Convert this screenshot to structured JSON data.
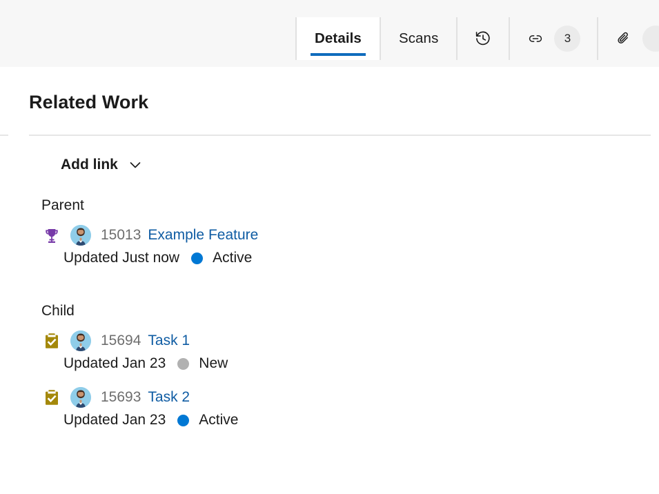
{
  "tabbar": {
    "tabs": [
      {
        "id": "details",
        "label": "Details",
        "kind": "text",
        "selected": true
      },
      {
        "id": "scans",
        "label": "Scans",
        "kind": "text",
        "selected": false
      },
      {
        "id": "history",
        "icon": "history-icon",
        "kind": "icon",
        "selected": false
      },
      {
        "id": "links",
        "icon": "link-icon",
        "kind": "icon",
        "badge": "3",
        "selected": false
      },
      {
        "id": "attachments",
        "icon": "paperclip-icon",
        "kind": "icon",
        "badge": "",
        "selected": false
      }
    ],
    "accent_color": "#0f6cbd",
    "bar_background": "#f7f7f7",
    "badge_background": "#ebebeb"
  },
  "main": {
    "title": "Related Work",
    "add_link": {
      "label": "Add link",
      "chevron": "chevron-down-icon"
    },
    "groups": [
      {
        "name": "Parent",
        "items": [
          {
            "type_icon": "feature-trophy-icon",
            "type_color": "#773aa8",
            "avatar": "person-avatar",
            "id": "15013",
            "title": "Example Feature",
            "updated": "Updated Just now",
            "state": "Active",
            "state_color": "#0078d4"
          }
        ]
      },
      {
        "name": "Child",
        "items": [
          {
            "type_icon": "task-clipboard-icon",
            "type_color": "#a4880a",
            "avatar": "person-avatar",
            "id": "15694",
            "title": "Task 1",
            "updated": "Updated Jan 23",
            "state": "New",
            "state_color": "#b1b1b1"
          },
          {
            "type_icon": "task-clipboard-icon",
            "type_color": "#a4880a",
            "avatar": "person-avatar",
            "id": "15693",
            "title": "Task 2",
            "updated": "Updated Jan 23",
            "state": "Active",
            "state_color": "#0078d4"
          }
        ]
      }
    ]
  },
  "colors": {
    "link": "#0f5ca3",
    "id_text": "#6e6e6e",
    "divider": "#e6e6e6",
    "text": "#1b1b1b"
  }
}
